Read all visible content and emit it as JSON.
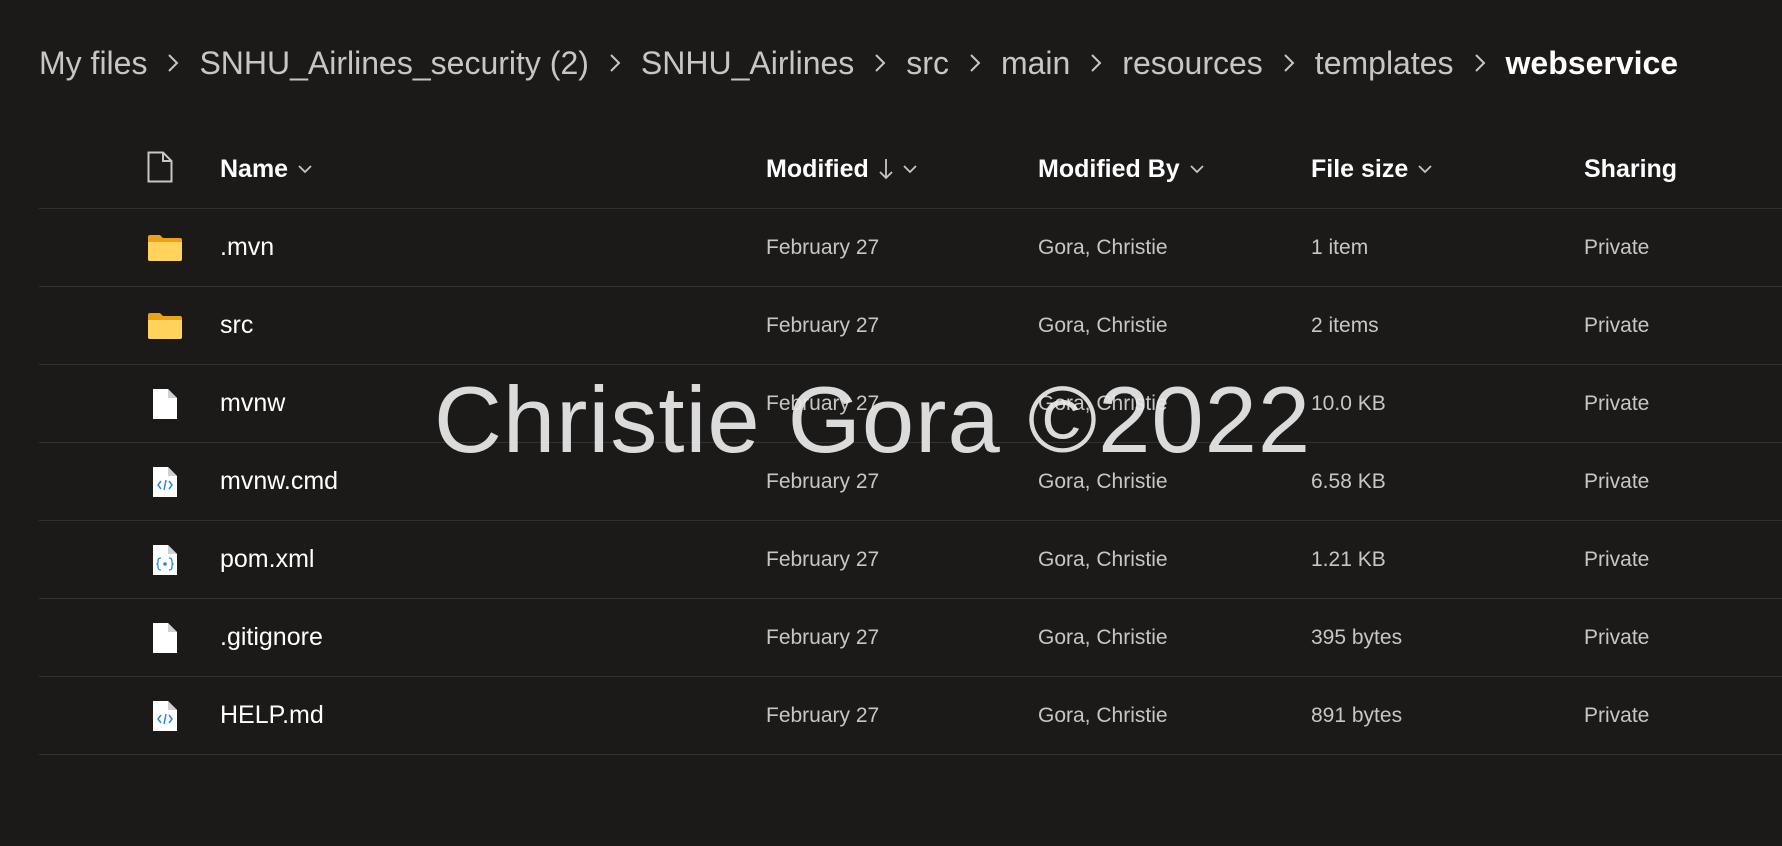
{
  "breadcrumb": {
    "items": [
      {
        "label": "My files"
      },
      {
        "label": "SNHU_Airlines_security (2)"
      },
      {
        "label": "SNHU_Airlines"
      },
      {
        "label": "src"
      },
      {
        "label": "main"
      },
      {
        "label": "resources"
      },
      {
        "label": "templates"
      },
      {
        "label": "webservice"
      }
    ]
  },
  "table": {
    "headers": {
      "name": "Name",
      "modified": "Modified",
      "modified_by": "Modified By",
      "file_size": "File size",
      "sharing": "Sharing"
    },
    "rows": [
      {
        "icon": "folder-icon",
        "name": ".mvn",
        "modified": "February 27",
        "modified_by": "Gora, Christie",
        "file_size": "1 item",
        "sharing": "Private"
      },
      {
        "icon": "folder-icon",
        "name": "src",
        "modified": "February 27",
        "modified_by": "Gora, Christie",
        "file_size": "2 items",
        "sharing": "Private"
      },
      {
        "icon": "file-icon",
        "name": "mvnw",
        "modified": "February 27",
        "modified_by": "Gora, Christie",
        "file_size": "10.0 KB",
        "sharing": "Private"
      },
      {
        "icon": "code-file-icon",
        "name": "mvnw.cmd",
        "modified": "February 27",
        "modified_by": "Gora, Christie",
        "file_size": "6.58 KB",
        "sharing": "Private"
      },
      {
        "icon": "xml-file-icon",
        "name": "pom.xml",
        "modified": "February 27",
        "modified_by": "Gora, Christie",
        "file_size": "1.21 KB",
        "sharing": "Private"
      },
      {
        "icon": "file-icon",
        "name": ".gitignore",
        "modified": "February 27",
        "modified_by": "Gora, Christie",
        "file_size": "395 bytes",
        "sharing": "Private"
      },
      {
        "icon": "code-file-icon",
        "name": "HELP.md",
        "modified": "February 27",
        "modified_by": "Gora, Christie",
        "file_size": "891 bytes",
        "sharing": "Private"
      }
    ]
  },
  "watermark": "Christie Gora ©2022",
  "colors": {
    "background": "#1b1a19",
    "folder": "#ffd35c",
    "text_primary": "#ffffff",
    "text_secondary": "#c8c6c4",
    "divider": "#323130",
    "code_accent": "#2b88d8"
  }
}
